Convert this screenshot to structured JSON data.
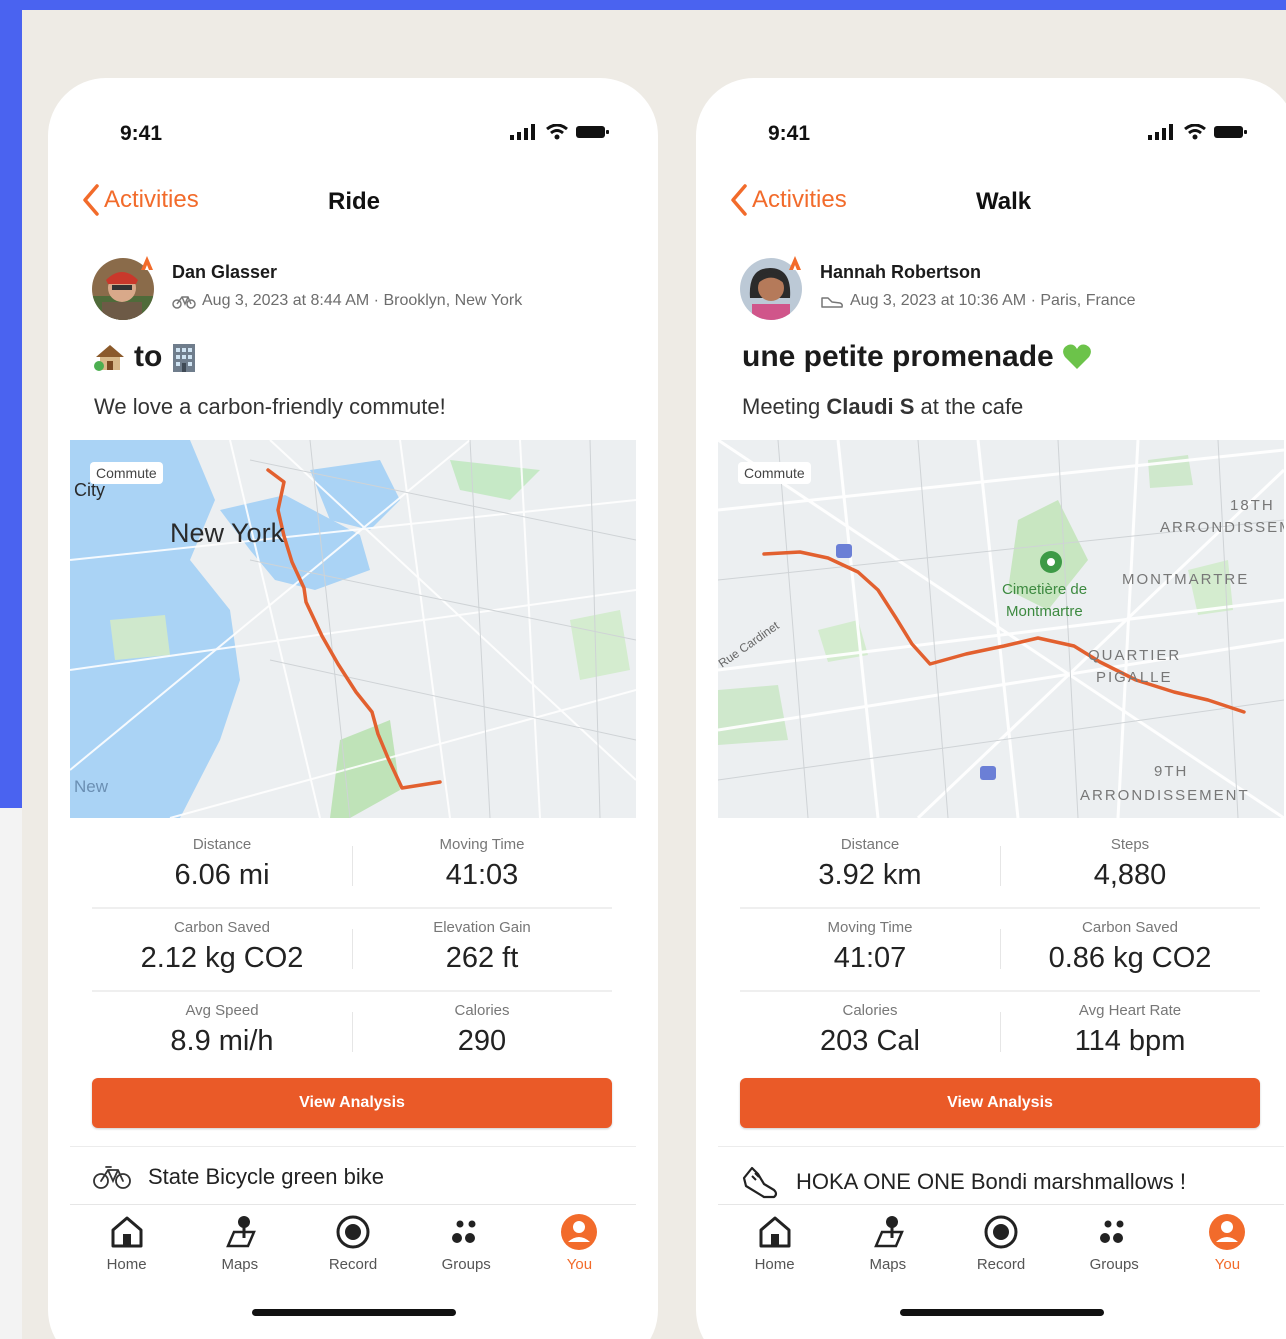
{
  "phones": [
    {
      "status_time": "9:41",
      "back_label": "Activities",
      "nav_title": "Ride",
      "author_name": "Dan Glasser",
      "author_meta": "Aug 3, 2023 at 8:44 AM · Brooklyn, New York",
      "title_text": "to",
      "description": "We love a carbon-friendly commute!",
      "map_tag": "Commute",
      "map_labels": {
        "city": "New York",
        "city_partial": "City",
        "water_label": "New"
      },
      "stats": [
        {
          "left_label": "Distance",
          "left_value": "6.06 mi",
          "right_label": "Moving Time",
          "right_value": "41:03"
        },
        {
          "left_label": "Carbon Saved",
          "left_value": "2.12 kg CO2",
          "right_label": "Elevation Gain",
          "right_value": "262 ft"
        },
        {
          "left_label": "Avg Speed",
          "left_value": "8.9 mi/h",
          "right_label": "Calories",
          "right_value": "290"
        }
      ],
      "button_label": "View Analysis",
      "gear": "State Bicycle green bike",
      "tabs": [
        "Home",
        "Maps",
        "Record",
        "Groups",
        "You"
      ]
    },
    {
      "status_time": "9:41",
      "back_label": "Activities",
      "nav_title": "Walk",
      "author_name": "Hannah Robertson",
      "author_meta": "Aug 3, 2023 at 10:36 AM · Paris, France",
      "title_text": "une petite promenade",
      "description_prefix": "Meeting",
      "description_bold": "Claudi S",
      "description_suffix": "at the cafe",
      "map_tag": "Commute",
      "map_labels": {
        "arr18_line1": "18TH",
        "arr18_line2": "ARRONDISSEMENT",
        "cemetery_line1": "Cimetière de",
        "cemetery_line2": "Montmartre",
        "montmartre": "MONTMARTRE",
        "quartier_line1": "QUARTIER",
        "quartier_line2": "PIGALLE",
        "arr9_line1": "9TH",
        "arr9_line2": "ARRONDISSEMENT",
        "street": "Rue Cardinet"
      },
      "stats": [
        {
          "left_label": "Distance",
          "left_value": "3.92 km",
          "right_label": "Steps",
          "right_value": "4,880"
        },
        {
          "left_label": "Moving Time",
          "left_value": "41:07",
          "right_label": "Carbon Saved",
          "right_value": "0.86 kg CO2"
        },
        {
          "left_label": "Calories",
          "left_value": "203 Cal",
          "right_label": "Avg Heart Rate",
          "right_value": "114 bpm"
        }
      ],
      "button_label": "View Analysis",
      "gear": "HOKA ONE ONE Bondi marshmallows !",
      "tabs": [
        "Home",
        "Maps",
        "Record",
        "Groups",
        "You"
      ]
    }
  ],
  "colors": {
    "accent": "#f26b2b",
    "button": "#ea5a28",
    "route": "#e2602f",
    "background_blue": "#4a63f0"
  }
}
